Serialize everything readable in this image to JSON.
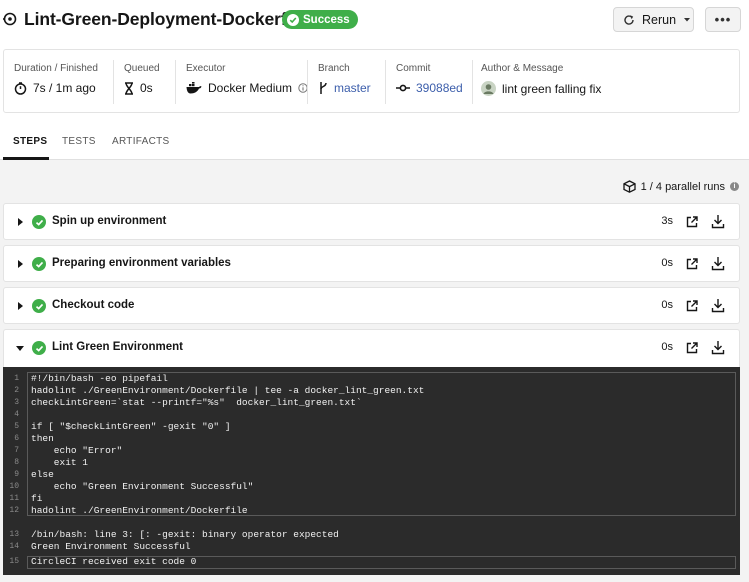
{
  "header": {
    "title": "Lint-Green-Deployment-Dockerfile",
    "status": "Success",
    "rerun_label": "Rerun",
    "more_label": "•••"
  },
  "summary": {
    "duration": {
      "label": "Duration / Finished",
      "value": "7s / 1m ago"
    },
    "queued": {
      "label": "Queued",
      "value": "0s"
    },
    "executor": {
      "label": "Executor",
      "value": "Docker Medium"
    },
    "branch": {
      "label": "Branch",
      "value": "master"
    },
    "commit": {
      "label": "Commit",
      "value": "39088ed"
    },
    "author": {
      "label": "Author & Message",
      "value": "lint green falling fix"
    }
  },
  "tabs": [
    {
      "label": "STEPS"
    },
    {
      "label": "TESTS"
    },
    {
      "label": "ARTIFACTS"
    }
  ],
  "parallel_runs": "1 / 4 parallel runs",
  "steps": [
    {
      "name": "Spin up environment",
      "duration": "3s"
    },
    {
      "name": "Preparing environment variables",
      "duration": "0s"
    },
    {
      "name": "Checkout code",
      "duration": "0s"
    },
    {
      "name": "Lint Green Environment",
      "duration": "0s"
    }
  ],
  "log_lines": [
    {
      "n": "1",
      "t": "#!/bin/bash -eo pipefail"
    },
    {
      "n": "2",
      "t": "hadolint ./GreenEnvironment/Dockerfile | tee -a docker_lint_green.txt"
    },
    {
      "n": "3",
      "t": "checkLintGreen=`stat --printf=\"%s\"  docker_lint_green.txt`"
    },
    {
      "n": "4",
      "t": ""
    },
    {
      "n": "5",
      "t": "if [ \"$checkLintGreen\" -gexit \"0\" ]"
    },
    {
      "n": "6",
      "t": "then"
    },
    {
      "n": "7",
      "t": "    echo \"Error\""
    },
    {
      "n": "8",
      "t": "    exit 1"
    },
    {
      "n": "9",
      "t": "else"
    },
    {
      "n": "10",
      "t": "    echo \"Green Environment Successful\""
    },
    {
      "n": "11",
      "t": "fi"
    },
    {
      "n": "12",
      "t": "hadolint ./GreenEnvironment/Dockerfile"
    },
    {
      "n": "13",
      "t": "/bin/bash: line 3: [: -gexit: binary operator expected"
    },
    {
      "n": "14",
      "t": "Green Environment Successful"
    },
    {
      "n": "15",
      "t": "CircleCI received exit code 0"
    }
  ],
  "colors": {
    "success": "#3fae49",
    "link": "#3c5eab",
    "log_bg": "#2b2b2b"
  }
}
